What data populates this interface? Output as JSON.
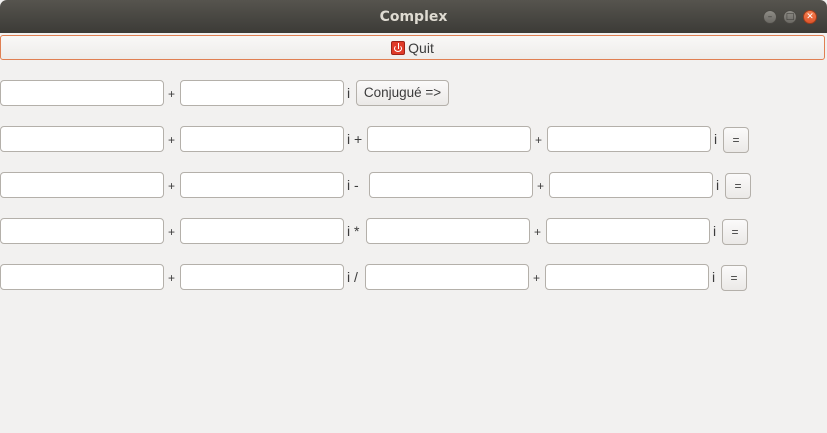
{
  "window": {
    "title": "Complex"
  },
  "toolbar": {
    "quit_label": "Quit"
  },
  "rows": {
    "conj": {
      "plus": "+",
      "i": "i",
      "button": "Conjugué =>"
    },
    "add": {
      "plus1": "+",
      "op": "i +",
      "plus2": "+",
      "i": "i",
      "button": "="
    },
    "sub": {
      "plus1": "+",
      "op": "i -",
      "plus2": "+",
      "i": "i",
      "button": "="
    },
    "mul": {
      "plus1": "+",
      "op": "i *",
      "plus2": "+",
      "i": "i",
      "button": "="
    },
    "div": {
      "plus1": "+",
      "op": "i /",
      "plus2": "+",
      "i": "i",
      "button": "="
    }
  }
}
